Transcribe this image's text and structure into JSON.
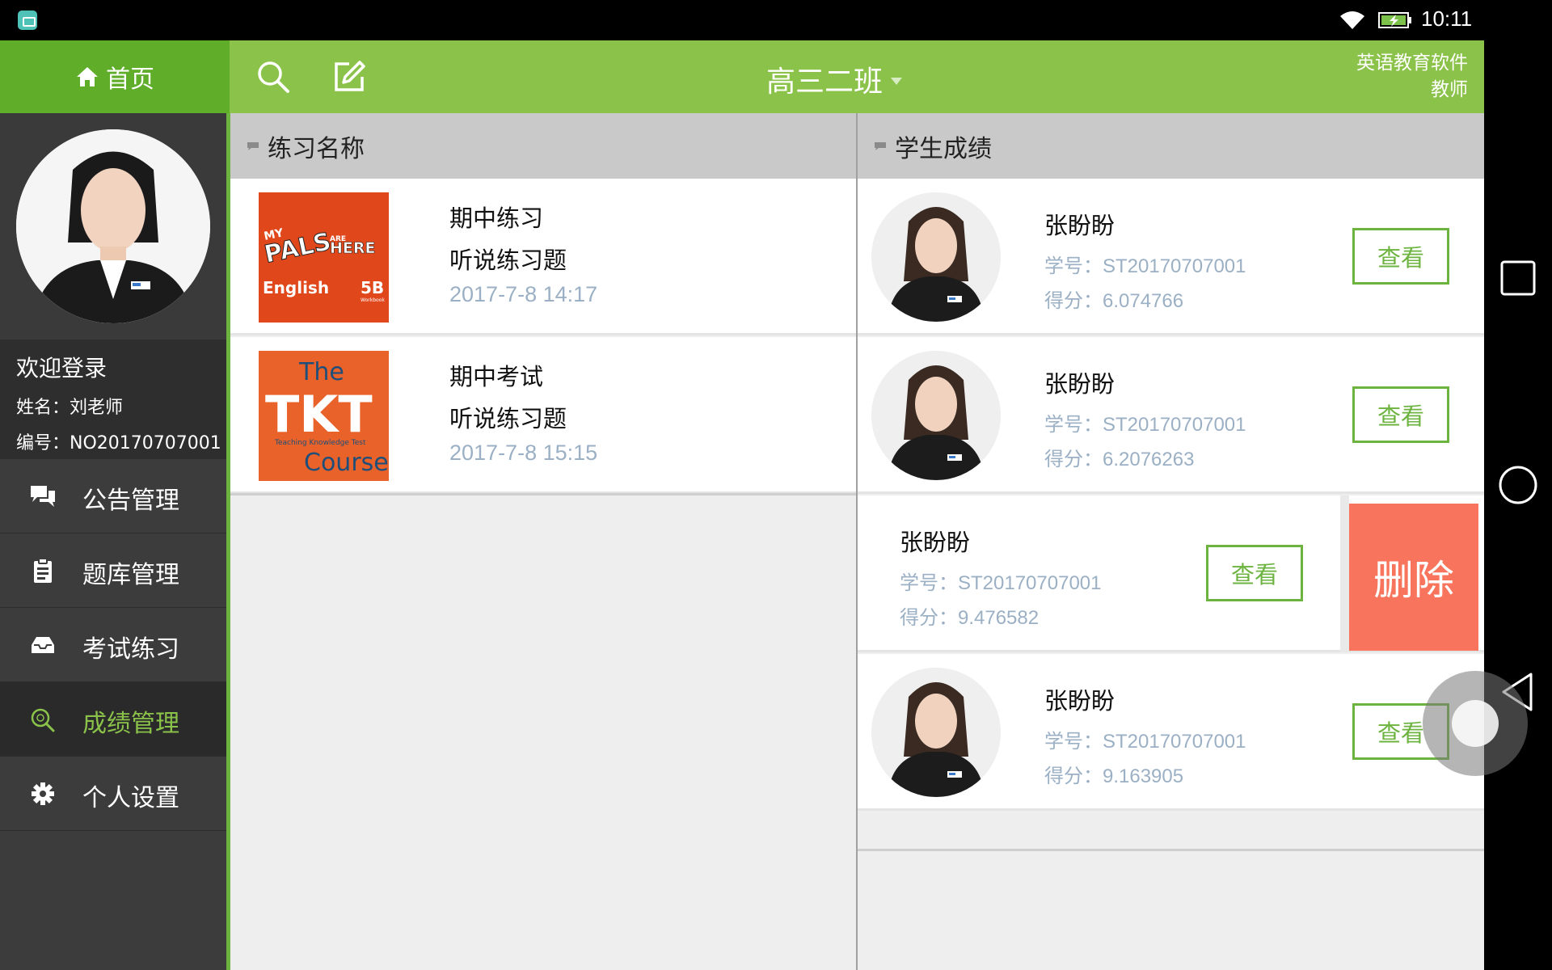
{
  "status_bar": {
    "time": "10:11"
  },
  "header": {
    "home_label": "首页",
    "class_name": "高三二班",
    "brand_line1": "英语教育软件",
    "brand_line2": "教师"
  },
  "sidebar": {
    "welcome": "欢迎登录",
    "name_line": "姓名：刘老师",
    "id_line": "编号：NO20170707001",
    "menu": [
      {
        "label": "公告管理",
        "icon": "chat-bubbles-icon",
        "active": false
      },
      {
        "label": "题库管理",
        "icon": "clipboard-icon",
        "active": false
      },
      {
        "label": "考试练习",
        "icon": "inbox-tray-icon",
        "active": false
      },
      {
        "label": "成绩管理",
        "icon": "magnify-score-icon",
        "active": true
      },
      {
        "label": "个人设置",
        "icon": "gear-icon",
        "active": false
      }
    ]
  },
  "exercises": {
    "header": "练习名称",
    "items": [
      {
        "title": "期中练习",
        "subtitle": "听说练习题",
        "time": "2017-7-8 14:17",
        "cover": {
          "l1": "MY",
          "l2": "PALS",
          "l3": "ARE",
          "l4": "HERE",
          "l5": "English",
          "l6": "5B",
          "l7": "Workbook"
        }
      },
      {
        "title": "期中考试",
        "subtitle": "听说练习题",
        "time": "2017-7-8 15:15",
        "cover": {
          "l1": "The",
          "l2": "TKT",
          "l3": "Teaching Knowledge Test",
          "l4": "Course"
        }
      }
    ]
  },
  "scores": {
    "header": "学生成绩",
    "view_label": "查看",
    "delete_label": "删除",
    "items": [
      {
        "name": "张盼盼",
        "id": "学号：ST20170707001",
        "score": "得分：6.074766"
      },
      {
        "name": "张盼盼",
        "id": "学号：ST20170707001",
        "score": "得分：6.2076263"
      },
      {
        "name": "张盼盼",
        "id": "学号：ST20170707001",
        "score": "得分：9.476582"
      },
      {
        "name": "张盼盼",
        "id": "学号：ST20170707001",
        "score": "得分：9.163905"
      }
    ]
  },
  "colors": {
    "accent": "#8bc34a",
    "accent_dark": "#5fad28",
    "delete": "#f8745c",
    "muted_text": "#9bb0c4"
  }
}
